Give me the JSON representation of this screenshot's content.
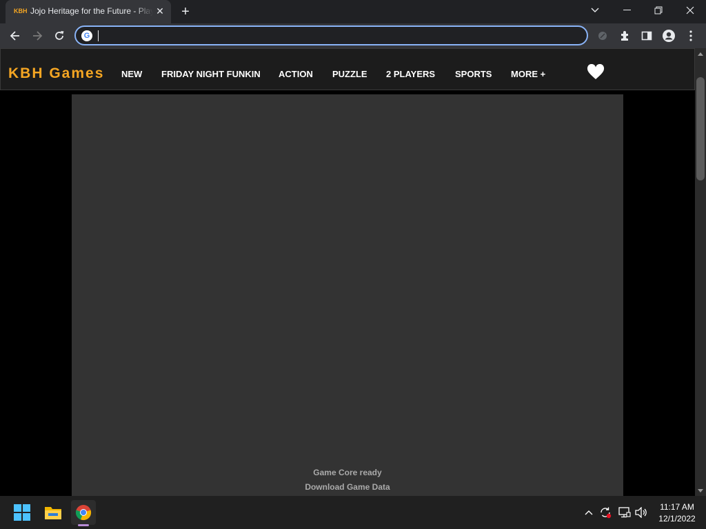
{
  "browser": {
    "tab": {
      "favicon_text": "KBH",
      "title": "Jojo Heritage for the Future - Play Online",
      "close_glyph": "✕"
    },
    "new_tab_glyph": "+",
    "omnibox": {
      "value": "",
      "placeholder": ""
    }
  },
  "site": {
    "logo": "KBH Games",
    "nav": [
      "NEW",
      "FRIDAY NIGHT FUNKIN",
      "ACTION",
      "PUZZLE",
      "2 PLAYERS",
      "SPORTS",
      "MORE +"
    ]
  },
  "game": {
    "status_line1": "Game Core ready",
    "status_line2": "Download Game Data"
  },
  "taskbar": {
    "time": "11:17 AM",
    "date": "12/1/2022"
  },
  "colors": {
    "logo": "#f5a623",
    "game_bg": "#333333",
    "omnibox_focus": "#8ab4f8"
  }
}
